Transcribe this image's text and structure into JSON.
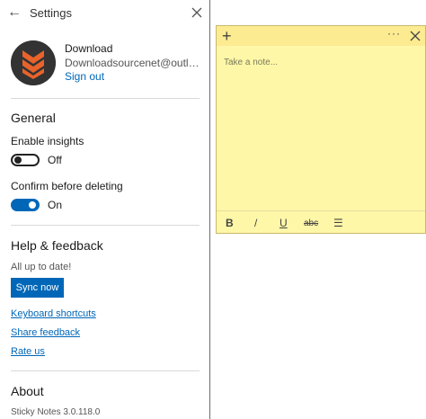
{
  "header": {
    "title": "Settings"
  },
  "account": {
    "name": "Download",
    "email": "Downloadsourcenet@outlook.com",
    "sign_out": "Sign out"
  },
  "general": {
    "title": "General",
    "insights_label": "Enable insights",
    "insights_state": "Off",
    "confirm_label": "Confirm before deleting",
    "confirm_state": "On"
  },
  "help": {
    "title": "Help & feedback",
    "status": "All up to date!",
    "sync_button": "Sync now",
    "links": [
      "Keyboard shortcuts",
      "Share feedback",
      "Rate us"
    ]
  },
  "about": {
    "title": "About",
    "version": "Sticky Notes 3.0.118.0"
  },
  "note": {
    "placeholder": "Take a note...",
    "toolbar": {
      "bold": "B",
      "italic": "/",
      "underline": "U",
      "strike": "abc",
      "list": "☰"
    }
  },
  "colors": {
    "accent": "#0067b8",
    "note_bg": "#fff7a8",
    "note_header": "#fdeb92"
  }
}
